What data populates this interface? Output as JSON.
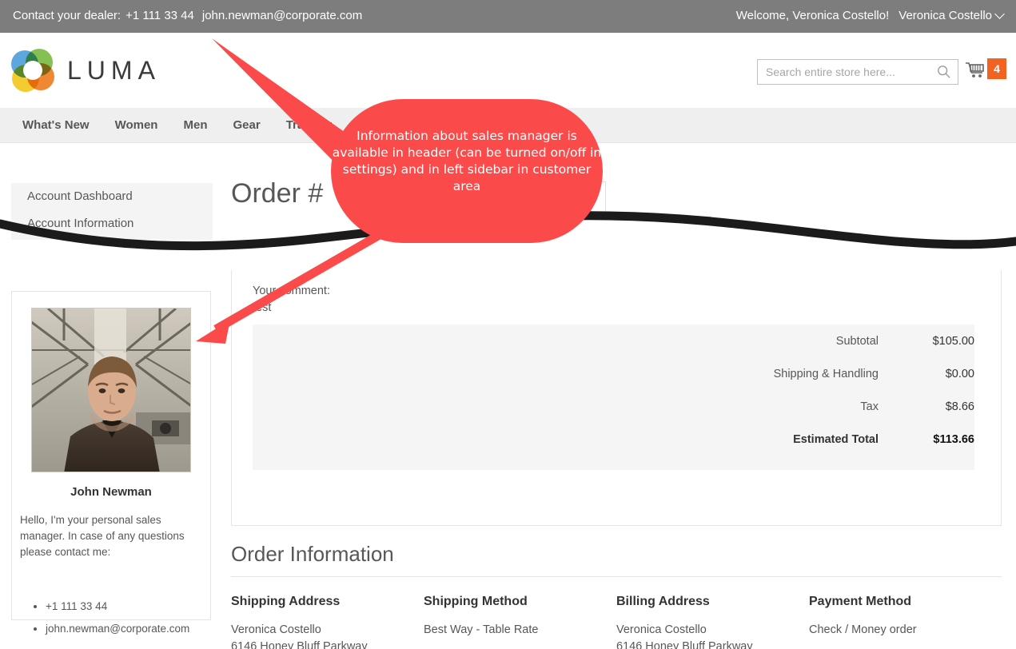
{
  "topbar": {
    "contact_label": "Contact your dealer:",
    "contact_phone": "+1 111 33 44",
    "contact_email": "john.newman@corporate.com",
    "welcome": "Welcome, Veronica Costello!",
    "account_name": "Veronica Costello",
    "caret_icon": "chevron-down-icon"
  },
  "header": {
    "logo_text": "LUMA",
    "logo_icon": "luma-flower-logo-icon",
    "search": {
      "placeholder": "Search entire store here...",
      "value": "",
      "icon": "search-icon"
    },
    "cart": {
      "icon": "shopping-cart-icon",
      "count": "4",
      "badge_color": "#f26322"
    }
  },
  "nav": {
    "items": [
      {
        "label": "What's New"
      },
      {
        "label": "Women"
      },
      {
        "label": "Men"
      },
      {
        "label": "Gear"
      },
      {
        "label": "Training"
      }
    ]
  },
  "sidebar": {
    "items": [
      {
        "label": "Account Dashboard"
      },
      {
        "label": "Account Information"
      }
    ]
  },
  "page": {
    "title": "Order #"
  },
  "manager_card": {
    "photo_alt": "john-newman-photo",
    "name": "John Newman",
    "intro": "Hello, I'm your personal sales manager. In case of any questions please contact me:",
    "contacts": [
      {
        "label": "+1 111 33 44"
      },
      {
        "label": "john.newman@corporate.com"
      }
    ]
  },
  "order_summary": {
    "comment_label": "Your comment:",
    "comment_value": "test",
    "rows": [
      {
        "label": "Subtotal",
        "value": "$105.00"
      },
      {
        "label": "Shipping & Handling",
        "value": "$0.00"
      },
      {
        "label": "Tax",
        "value": "$8.66"
      }
    ],
    "total": {
      "label": "Estimated Total",
      "value": "$113.66"
    }
  },
  "order_information": {
    "title": "Order Information",
    "columns": [
      {
        "heading": "Shipping Address",
        "lines": "Veronica Costello\n6146 Honey Bluff Parkway"
      },
      {
        "heading": "Shipping Method",
        "lines": "Best Way - Table Rate"
      },
      {
        "heading": "Billing Address",
        "lines": "Veronica Costello\n6146 Honey Bluff Parkway"
      },
      {
        "heading": "Payment Method",
        "lines": "Check / Money order"
      }
    ]
  },
  "callout": {
    "text": "Information about sales manager is available in header (can be turned on/off in settings) and in left sidebar in customer area",
    "color": "#fa4a4a"
  }
}
